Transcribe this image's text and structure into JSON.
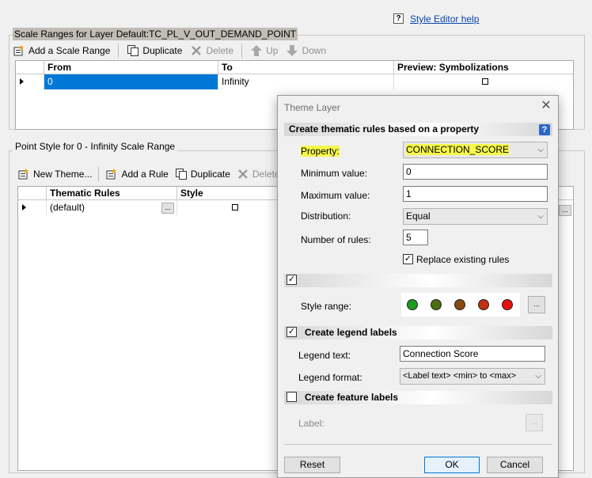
{
  "help": {
    "icon": "question-icon",
    "link_text": "Style Editor help",
    "q": "?"
  },
  "scale_ranges": {
    "title": "Scale Ranges for Layer Default:TC_PL_V_OUT_DEMAND_POINT",
    "toolbar": {
      "add": "Add a Scale Range",
      "duplicate": "Duplicate",
      "delete": "Delete",
      "up": "Up",
      "down": "Down"
    },
    "columns": [
      "From",
      "To",
      "Preview: Symbolizations"
    ],
    "rows": [
      {
        "from": "0",
        "to": "Infinity"
      }
    ]
  },
  "point_style": {
    "title": "Point Style for 0 - Infinity Scale Range",
    "toolbar": {
      "new_theme": "New Theme...",
      "add_rule": "Add a Rule",
      "duplicate": "Duplicate",
      "delete": "Delete"
    },
    "columns": [
      "Thematic Rules",
      "Style"
    ],
    "rows": [
      {
        "rule": "(default)",
        "ellipsis": "..."
      }
    ]
  },
  "dialog": {
    "title": "Theme Layer",
    "close": "✕",
    "section1": "Create thematic rules based on a property",
    "help_badge": "?",
    "property_label": "Property:",
    "property_value": "CONNECTION_SCORE",
    "min_label": "Minimum value:",
    "min_value": "0",
    "max_label": "Maximum value:",
    "max_value": "1",
    "distribution_label": "Distribution:",
    "distribution_value": "Equal",
    "num_rules_label": "Number of rules:",
    "num_rules_value": "5",
    "replace_label": "Replace existing rules",
    "replace_checked": true,
    "style_section_checked": true,
    "style_range_label": "Style range:",
    "style_colors": [
      "#1e9a1e",
      "#4a6e12",
      "#8a4a12",
      "#c4310e",
      "#e8110f"
    ],
    "style_ellipsis": "...",
    "legend_section": "Create legend labels",
    "legend_checked": true,
    "legend_text_label": "Legend text:",
    "legend_text_value": "Connection Score",
    "legend_format_label": "Legend format:",
    "legend_format_value": "<Label text> <min> to <max>",
    "feature_section": "Create feature labels",
    "feature_checked": false,
    "label_label": "Label:",
    "label_ellipsis": "...",
    "reset": "Reset",
    "ok": "OK",
    "cancel": "Cancel",
    "check_mark": "✓",
    "chevron": "⌵"
  }
}
